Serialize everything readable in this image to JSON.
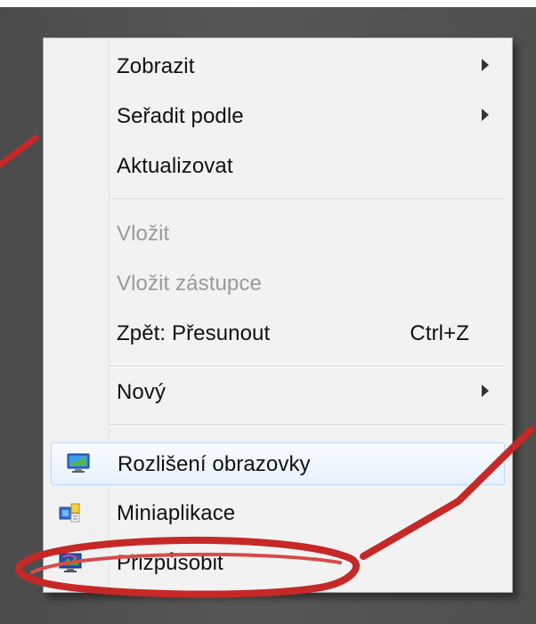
{
  "menu": {
    "items": [
      {
        "label": "Zobrazit",
        "has_submenu": true
      },
      {
        "label": "Seřadit podle",
        "has_submenu": true
      },
      {
        "label": "Aktualizovat"
      },
      {
        "label": "Vložit",
        "disabled": true
      },
      {
        "label": "Vložit zástupce",
        "disabled": true
      },
      {
        "label": "Zpět: Přesunout",
        "shortcut": "Ctrl+Z"
      },
      {
        "label": "Nový",
        "has_submenu": true
      },
      {
        "label": "Rozlišení obrazovky",
        "icon": "monitor-icon",
        "highlighted": true
      },
      {
        "label": "Miniaplikace",
        "icon": "gadget-icon"
      },
      {
        "label": "Přizpůsobit",
        "icon": "personalize-icon"
      }
    ]
  },
  "colors": {
    "annotation": "#c62828",
    "highlight_border": "#b8d6fb",
    "highlight_fill": "#e7f1fe",
    "disabled_text": "#9a9a9a"
  }
}
